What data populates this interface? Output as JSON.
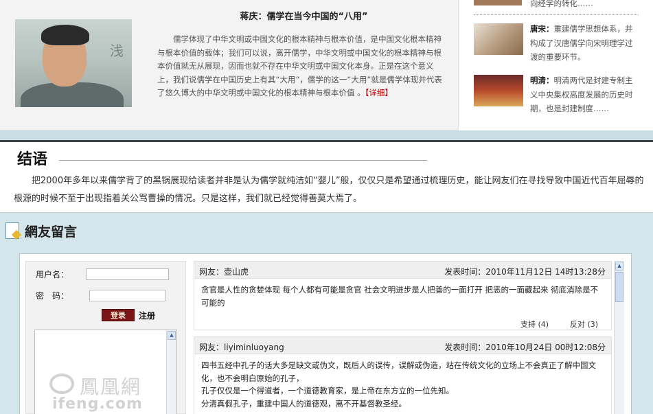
{
  "article": {
    "title": "蒋庆：儒学在当今中国的“八用”",
    "body": "儒学体现了中华文明或中国文化的根本精神与根本价值，是中国文化根本精神与根本价值的载体；我们可以说，离开儒学，中华文明或中国文化的根本精神与根本价值就无从展现，因而也就不存在中华文明或中国文化本身。正是在这个意义上，我们说儒学在中国历史上有其“大用”，儒学的这一“大用”就是儒学体现并代表了悠久博大的中华文明或中国文化的根本精神与根本价值 。",
    "more_link": "【详细】",
    "portrait_glyph": "浅"
  },
  "side_list": {
    "top_text": "向经学的转化……",
    "items": [
      {
        "era": "唐宋：",
        "text": "重建儒学思想体系，并构成了汉唐儒学向宋明理学过渡的重要环节。"
      },
      {
        "era": "明清：",
        "text": "明清两代是封建专制主义中央集权高度发展的历史时期，也是封建制度……"
      }
    ]
  },
  "conclusion": {
    "title": "结语",
    "text": "把2000年多年以来儒学背了的黑锅展现给读者并非是认为儒学就纯洁如“婴儿”般，仅仅只是希望通过梳理历史，能让网友们在寻找导致中国近代百年屈辱的根源的时候不至于出现指着关公骂曹操的情况。只是这样，我们就已经觉得善莫大焉了。"
  },
  "comments_section": {
    "title": "網友留言",
    "login": {
      "username_label": "用户名：",
      "password_label": "密　码：",
      "username_value": "",
      "password_value": "",
      "login_button": "登录",
      "register_link": "注册"
    },
    "watermark": {
      "cn": "鳳凰網",
      "en": "ifeng.com"
    },
    "comments": [
      {
        "author": "网友：壶山虎",
        "time": "发表时间：2010年11月12日 14时13:28分",
        "text": "贪官是人性的贪婪体现 每个人都有可能是贪官 社会文明进步是人把善的一面打开 把恶的一面藏起来 彻底消除是不可能的",
        "support": "支持 (4)",
        "oppose": "反对 (3)"
      },
      {
        "author": "网友：liyiminluoyang",
        "time": "发表时间：2010年10月24日 00时12:08分",
        "lines": [
          "四书五经中孔子的话大多是缺文或伪文，既后人的误传，误解或伪造，站在传统文化的立场上不会真正了解中国文化，也不会明白原始的孔子，",
          "孔子仅仅是一个得道者，一个道德教育家，是上帝在东方立的一位先知。",
          "分清真假孔子，重建中国人的道德观，离不开基督教圣经。"
        ]
      }
    ]
  }
}
